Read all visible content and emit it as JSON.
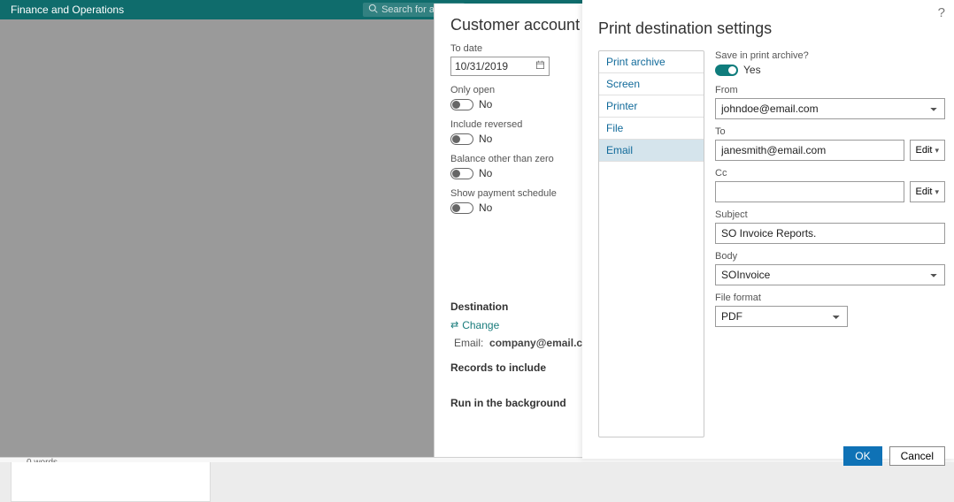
{
  "topbar": {
    "title": "Finance and Operations",
    "search_placeholder": "Search for a page"
  },
  "wordbar": {
    "words": "0 words"
  },
  "slideout": {
    "title": "Customer account statem",
    "to_date_label": "To date",
    "to_date_value": "10/31/2019",
    "only_open_label": "Only open",
    "only_open_value": "No",
    "include_reversed_label": "Include reversed",
    "include_reversed_value": "No",
    "balance_label": "Balance other than zero",
    "balance_value": "No",
    "payment_schedule_label": "Show payment schedule",
    "payment_schedule_value": "No",
    "destination_hd": "Destination",
    "change_label": "Change",
    "email_label": "Email:",
    "email_value": "company@email.com",
    "records_hd": "Records to include",
    "background_hd": "Run in the background"
  },
  "dialog": {
    "title": "Print destination settings",
    "help": "?",
    "tabs": [
      "Print archive",
      "Screen",
      "Printer",
      "File",
      "Email"
    ],
    "selected_tab": 4,
    "archive_label": "Save in print archive?",
    "archive_value": "Yes",
    "from_label": "From",
    "from_value": "johndoe@email.com",
    "to_label": "To",
    "to_value": "janesmith@email.com",
    "cc_label": "Cc",
    "cc_value": "",
    "subject_label": "Subject",
    "subject_value": "SO Invoice Reports.",
    "body_label": "Body",
    "body_value": "SOInvoice",
    "file_format_label": "File format",
    "file_format_value": "PDF",
    "edit_label": "Edit",
    "ok_label": "OK",
    "cancel_label": "Cancel"
  }
}
